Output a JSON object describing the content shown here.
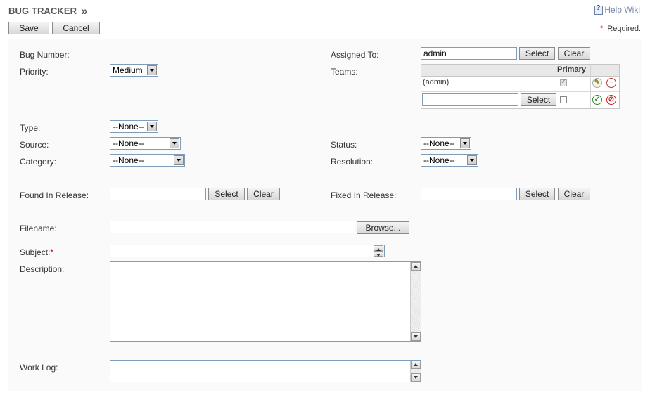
{
  "header": {
    "title": "BUG TRACKER",
    "chevron": "»",
    "help_label": "Help Wiki",
    "help_icon": "help-icon",
    "required_star": "*",
    "required_label": "Required."
  },
  "toolbar": {
    "save_label": "Save",
    "cancel_label": "Cancel"
  },
  "form": {
    "bug_number_label": "Bug Number:",
    "priority_label": "Priority:",
    "priority_value": "Medium",
    "type_label": "Type:",
    "type_value": "--None--",
    "source_label": "Source:",
    "source_value": "--None--",
    "category_label": "Category:",
    "category_value": "--None--",
    "found_release_label": "Found In Release:",
    "filename_label": "Filename:",
    "subject_label": "Subject:",
    "subject_star": "*",
    "description_label": "Description:",
    "work_log_label": "Work Log:",
    "assigned_to_label": "Assigned To:",
    "assigned_to_value": "admin",
    "teams_label": "Teams:",
    "teams": {
      "primary_header": "Primary",
      "row_name": "(admin)",
      "row_primary_checked": true
    },
    "status_label": "Status:",
    "status_value": "--None--",
    "resolution_label": "Resolution:",
    "resolution_value": "--None--",
    "fixed_release_label": "Fixed In Release:",
    "select_label": "Select",
    "clear_label": "Clear",
    "browse_label": "Browse..."
  },
  "colors": {
    "required_star": "#cc0000",
    "accept": "#2e8b2e",
    "cancel": "#cc2222"
  }
}
